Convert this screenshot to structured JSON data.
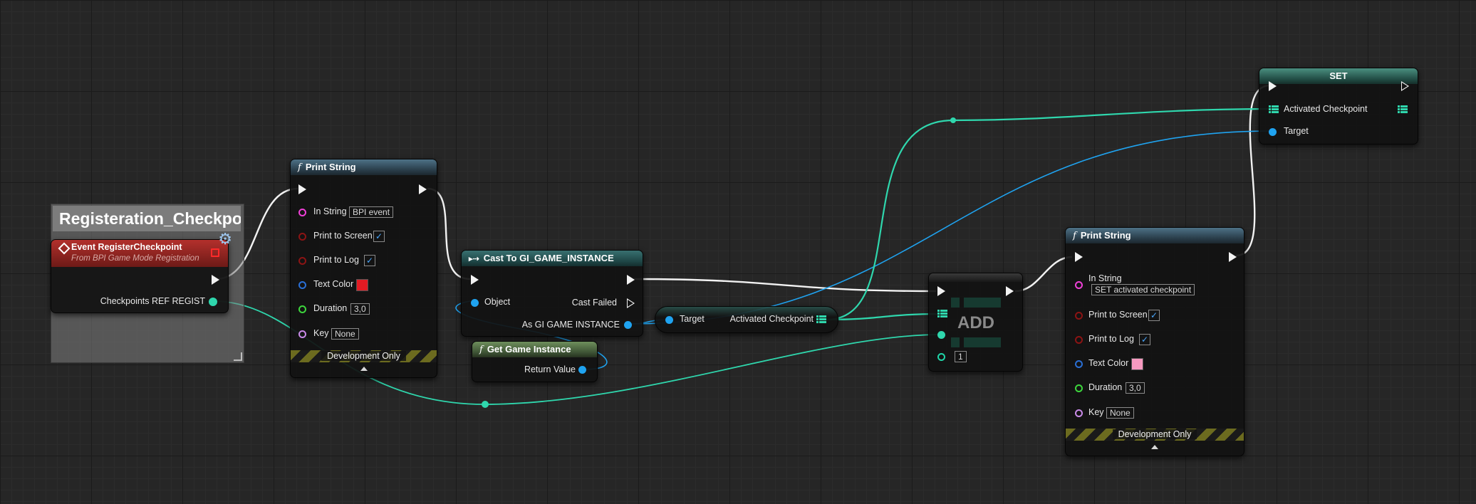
{
  "comment_box": {
    "title": "Registeration_Checkpo"
  },
  "event_node": {
    "title": "Event RegisterCheckpoint",
    "subtitle": "From BPI Game Mode Registration",
    "output_label": "Checkpoints REF REGIST"
  },
  "print_string_1": {
    "title": "Print String",
    "in_string_label": "In String",
    "in_string_value": "BPI event",
    "print_to_screen_label": "Print to Screen",
    "print_to_screen_checked": "✓",
    "print_to_log_label": "Print to Log",
    "print_to_log_checked": "✓",
    "text_color_label": "Text Color",
    "text_color_value": "#e31b23",
    "duration_label": "Duration",
    "duration_value": "3,0",
    "key_label": "Key",
    "key_value": "None",
    "dev_only_label": "Development Only"
  },
  "cast_node": {
    "title": "Cast To GI_GAME_INSTANCE",
    "object_label": "Object",
    "cast_failed_label": "Cast Failed",
    "as_label": "As GI GAME INSTANCE"
  },
  "get_game_instance": {
    "title": "Get Game Instance",
    "return_label": "Return Value"
  },
  "get_node": {
    "target_label": "Target",
    "output_label": "Activated Checkpoint"
  },
  "add_node": {
    "title": "ADD",
    "index_value": "1"
  },
  "print_string_2": {
    "title": "Print String",
    "in_string_label": "In String",
    "in_string_value": "SET activated checkpoint",
    "print_to_screen_label": "Print to Screen",
    "print_to_screen_checked": "✓",
    "print_to_log_label": "Print to Log",
    "print_to_log_checked": "✓",
    "text_color_label": "Text Color",
    "text_color_value": "#f79ac0",
    "duration_label": "Duration",
    "duration_value": "3,0",
    "key_label": "Key",
    "key_value": "None",
    "dev_only_label": "Development Only"
  },
  "set_node": {
    "title": "SET",
    "activated_label": "Activated Checkpoint",
    "target_label": "Target"
  },
  "colors": {
    "exec_wire": "#f2f2f2",
    "object_pin": "#1fa3f0",
    "array_pin": "#2fd7ad",
    "string_pin": "#f040d8",
    "bool_pin": "#8c1414",
    "color_pin": "#2a6fd6",
    "float_pin": "#3dd63d",
    "name_pin": "#c98ae8",
    "int_pin": "#1fd6a8"
  }
}
